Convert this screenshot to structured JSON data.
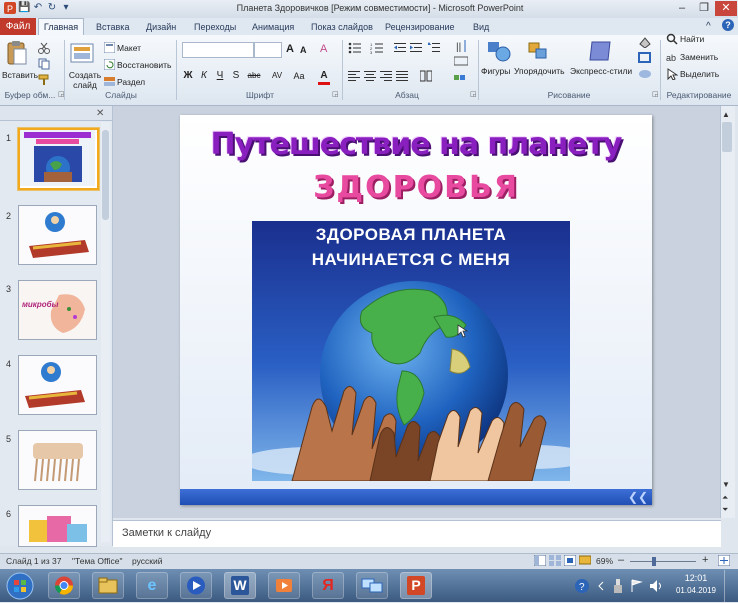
{
  "window": {
    "title": "Планета Здоровичков [Режим совместимости] - Microsoft PowerPoint",
    "minimize": "–",
    "maximize": "❐",
    "close": "✕"
  },
  "quick_access": {
    "save": "💾",
    "undo": "↶",
    "redo": "↻",
    "customize": "▾"
  },
  "tabs": {
    "file": "Файл",
    "home": "Главная",
    "items": [
      "Вставка",
      "Дизайн",
      "Переходы",
      "Анимация",
      "Показ слайдов",
      "Рецензирование",
      "Вид"
    ],
    "help": "?",
    "collapse": "^"
  },
  "ribbon": {
    "clipboard": {
      "paste": "Вставить",
      "label": "Буфер обм..."
    },
    "slides": {
      "new_slide": "Создать слайд",
      "layout": "Макет",
      "reset": "Восстановить",
      "section": "Раздел",
      "label": "Слайды"
    },
    "font": {
      "label": "Шрифт",
      "bold": "Ж",
      "italic": "К",
      "underline": "Ч",
      "shadow": "S",
      "strike": "abc",
      "spacing": "AV",
      "case": "Aa",
      "color": "A",
      "grow": "A",
      "shrink": "A",
      "clear": "A"
    },
    "paragraph": {
      "label": "Абзац"
    },
    "drawing": {
      "shapes": "Фигуры",
      "arrange": "Упорядочить",
      "quick_styles": "Экспресс-стили",
      "label": "Рисование"
    },
    "editing": {
      "find": "Найти",
      "replace": "Заменить",
      "select": "Выделить",
      "label": "Редактирование"
    }
  },
  "thumbnails": {
    "numbers": [
      "1",
      "2",
      "3",
      "4",
      "5",
      "6"
    ],
    "slide3_word": "микробы"
  },
  "slide": {
    "title_line1": "Путешествие на планету",
    "title_line2": "ЗДОРОВЬЯ",
    "caption_line1": "ЗДОРОВАЯ ПЛАНЕТА",
    "caption_line2": "НАЧИНАЕТСЯ С МЕНЯ"
  },
  "notes": {
    "placeholder": "Заметки к слайду"
  },
  "statusbar": {
    "slide_info": "Слайд 1 из 37",
    "theme": "\"Тема Office\"",
    "language": "русский",
    "zoom": "69%",
    "zoom_out": "–",
    "zoom_in": "+"
  },
  "taskbar": {
    "time": "12:01",
    "date": "01.04.2019",
    "apps": [
      "start",
      "chrome",
      "explorer",
      "ie",
      "media",
      "word",
      "video",
      "yandex",
      "network",
      "powerpoint"
    ]
  },
  "colors": {
    "file_tab": "#c0392b",
    "title_purple": "#8a1fbf",
    "title_pink": "#e84aa0",
    "slide_bar": "#1f4fb5",
    "thumb_selected": "#f2a91d"
  }
}
